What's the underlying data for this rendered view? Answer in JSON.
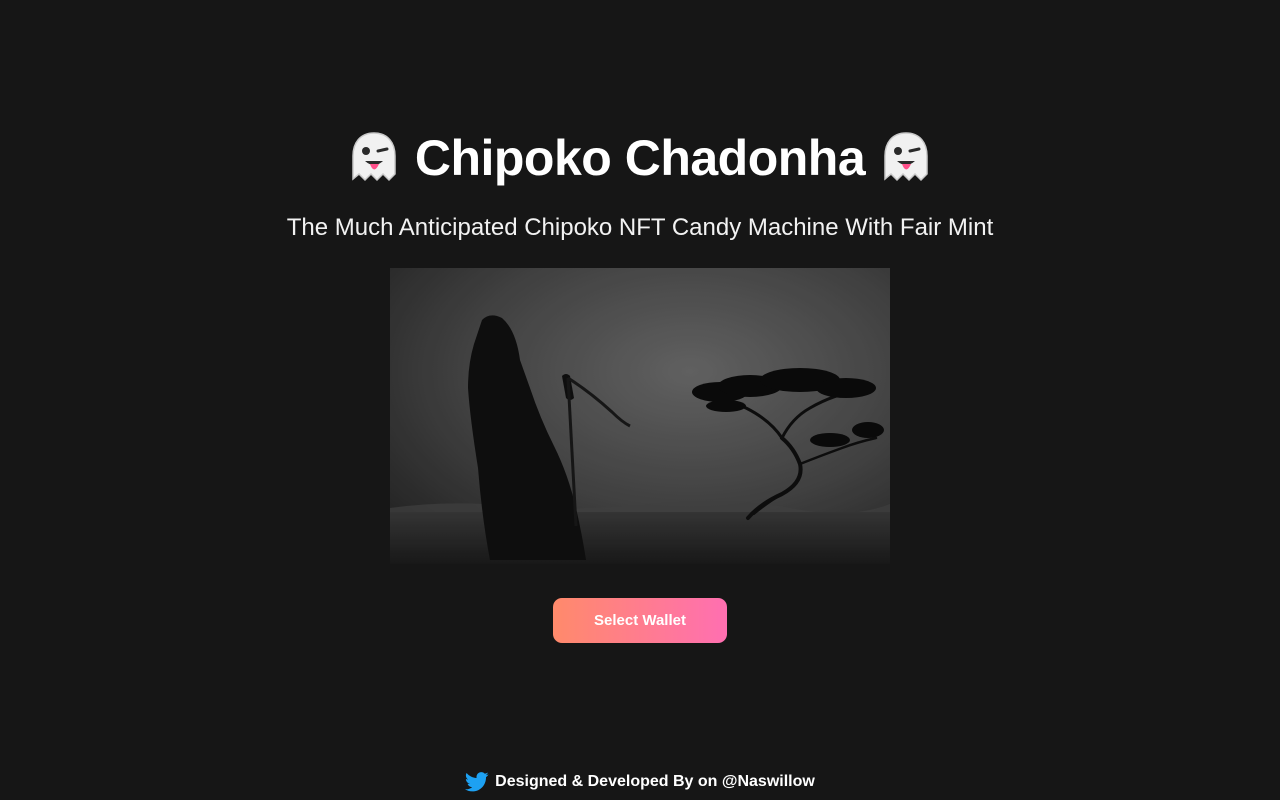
{
  "header": {
    "title": "Chipoko Chadonha",
    "title_emoji": "ghost-icon"
  },
  "subtitle": "The Much Anticipated Chipoko NFT Candy Machine With Fair Mint",
  "hero_image": {
    "icon": "grim-reaper-tree-image"
  },
  "actions": {
    "select_wallet_label": "Select Wallet"
  },
  "footer": {
    "text": "Designed & Developed By on @Naswillow",
    "icon": "twitter-icon"
  },
  "colors": {
    "background": "#161616",
    "button_gradient_start": "#ff8a6b",
    "button_gradient_end": "#ff6fb1",
    "twitter_blue": "#1da1f2"
  }
}
